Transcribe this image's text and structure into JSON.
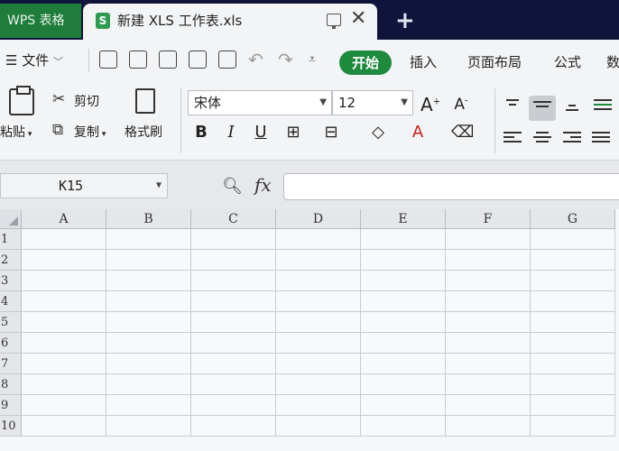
{
  "tabs": {
    "app_tab": "WPS 表格",
    "doc_tab": "新建 XLS 工作表.xls",
    "doc_logo": "S"
  },
  "menu": {
    "file_label": "文件",
    "tabs": [
      "开始",
      "插入",
      "页面布局",
      "公式",
      "数"
    ]
  },
  "ribbon": {
    "paste_label": "粘贴",
    "cut_label": "剪切",
    "copy_label": "复制",
    "format_painter_label": "格式刷",
    "font_name": "宋体",
    "font_size": "12",
    "bold": "B",
    "italic": "I",
    "underline": "U",
    "font_color_letter": "A",
    "grow_font": "A",
    "shrink_font": "A"
  },
  "formula_bar": {
    "cell_ref": "K15",
    "fx_label": "fx",
    "value": ""
  },
  "grid": {
    "columns": [
      "A",
      "B",
      "C",
      "D",
      "E",
      "F",
      "G"
    ],
    "rows": [
      "1",
      "2",
      "3",
      "4",
      "5",
      "6",
      "7",
      "8",
      "9",
      "10"
    ]
  },
  "colors": {
    "tabbar_bg": "#10143a",
    "app_tab_green": "#1e7d3a",
    "active_menu_green": "#1e8a3e"
  }
}
